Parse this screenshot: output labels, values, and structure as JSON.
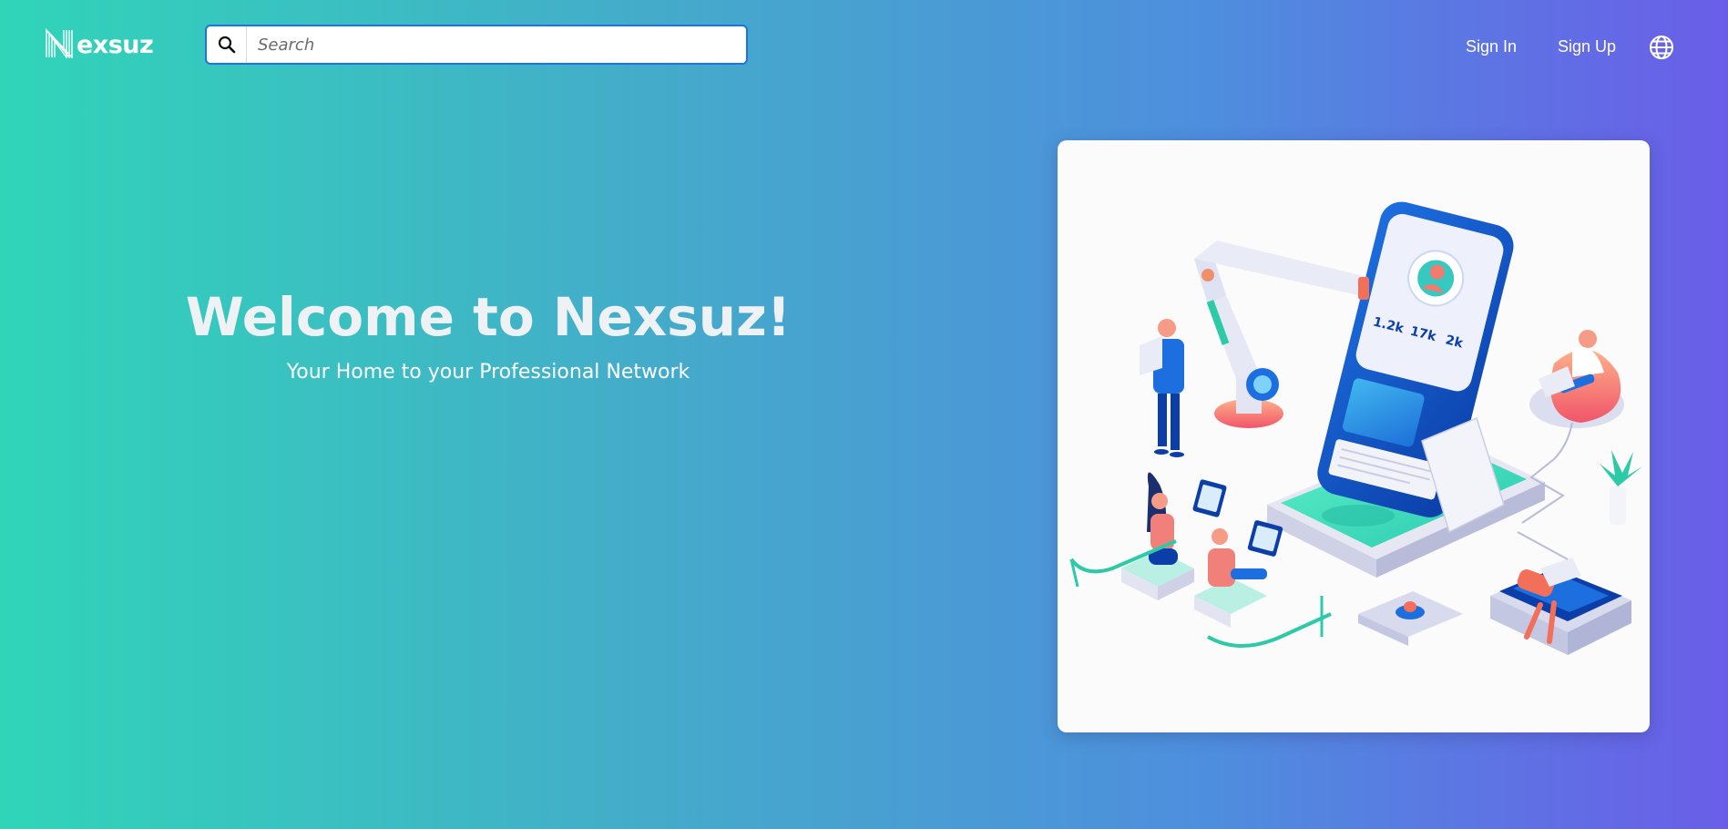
{
  "header": {
    "logo_text": "exsuz",
    "logo_letter": "N",
    "search": {
      "placeholder": "Search",
      "value": ""
    },
    "nav": {
      "sign_in": "Sign In",
      "sign_up": "Sign Up",
      "language_icon": "globe-icon"
    }
  },
  "hero": {
    "title": "Welcome to Nexsuz!",
    "subtitle": "Your Home to your Professional Network"
  },
  "illustration": {
    "stats": [
      "1.2k",
      "17k",
      "2k"
    ]
  },
  "colors": {
    "gradient_start": "#30d5b8",
    "gradient_end": "#6a5ee8",
    "search_border": "#1a73e8",
    "text": "#ffffff"
  }
}
